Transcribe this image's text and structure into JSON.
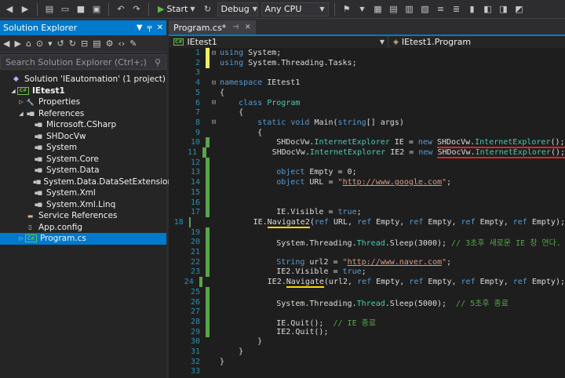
{
  "toolbar": {
    "start_label": "Start",
    "config_value": "Debug",
    "platform_value": "Any CPU"
  },
  "solution_explorer": {
    "title": "Solution Explorer",
    "search_placeholder": "Search Solution Explorer (Ctrl+;)",
    "solution": "Solution 'IEautomation' (1 project)",
    "project": "IEtest1",
    "properties": "Properties",
    "references": "References",
    "reference_items": [
      "Microsoft.CSharp",
      "SHDocVw",
      "System",
      "System.Core",
      "System.Data",
      "System.Data.DataSetExtensions",
      "System.Xml",
      "System.Xml.Linq"
    ],
    "service_references": "Service References",
    "app_config": "App.config",
    "program_cs": "Program.cs"
  },
  "editor": {
    "tab_label": "Program.cs*",
    "nav_project": "IEtest1",
    "nav_class": "IEtest1.Program",
    "line_numbers": [
      "1",
      "2",
      "3",
      "4",
      "5",
      "6",
      "7",
      "8",
      "9",
      "10",
      "11",
      "12",
      "13",
      "14",
      "15",
      "16",
      "17",
      "18",
      "19",
      "20",
      "21",
      "22",
      "23",
      "24",
      "25",
      "26",
      "27",
      "28",
      "29",
      "30",
      "31",
      "32",
      "33"
    ]
  },
  "icons": {
    "play": "play-icon",
    "solution": "solution-icon",
    "folder": "folder-icon"
  },
  "colors": {
    "accent": "#007acc",
    "keyword": "#569cd6",
    "type": "#4ec9b0",
    "string": "#d69d85",
    "comment": "#57a64a",
    "annotation_red": "#e0241b",
    "annotation_yellow": "#ffd700"
  }
}
